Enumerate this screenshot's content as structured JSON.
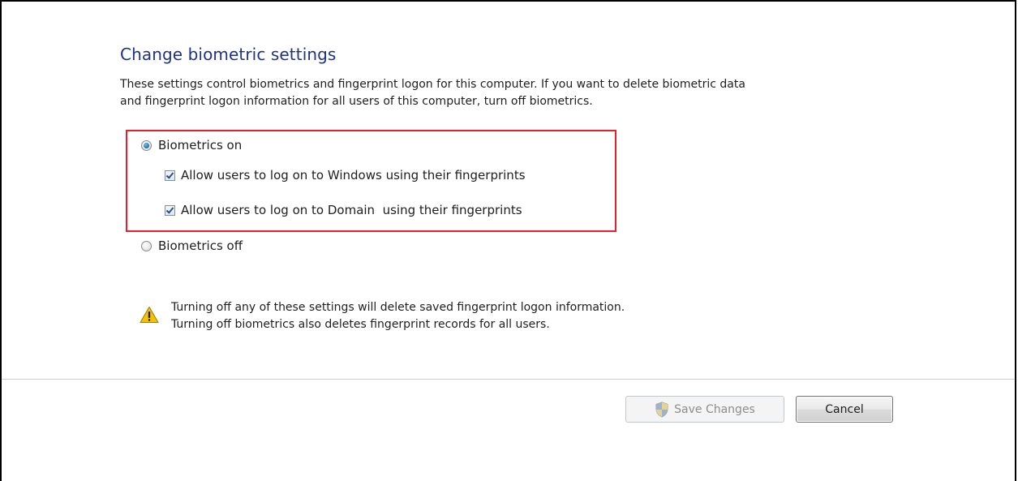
{
  "title": "Change biometric settings",
  "description": {
    "line1": "These settings control biometrics and fingerprint logon for this computer. If you want to delete biometric data",
    "line2": "and fingerprint logon information for all users of this computer, turn off biometrics."
  },
  "options": {
    "biometrics_on": "Biometrics on",
    "allow_windows": "Allow users to log on to Windows using their fingerprints",
    "allow_domain": "Allow users to log on to Domain  using their fingerprints",
    "biometrics_off": "Biometrics off"
  },
  "state": {
    "biometrics_on_selected": true,
    "allow_windows_checked": true,
    "allow_domain_checked": true
  },
  "warning": {
    "line1": "Turning off any of these settings will delete saved fingerprint logon information.",
    "line2": "Turning off biometrics also deletes fingerprint records for all users."
  },
  "buttons": {
    "save": "Save Changes",
    "cancel": "Cancel"
  },
  "colors": {
    "title": "#1e3287",
    "highlight_border": "#e8202a",
    "warning_fill": "#f5c400"
  },
  "icons": {
    "warning": "warning-icon",
    "uac_shield": "uac-shield-icon"
  }
}
